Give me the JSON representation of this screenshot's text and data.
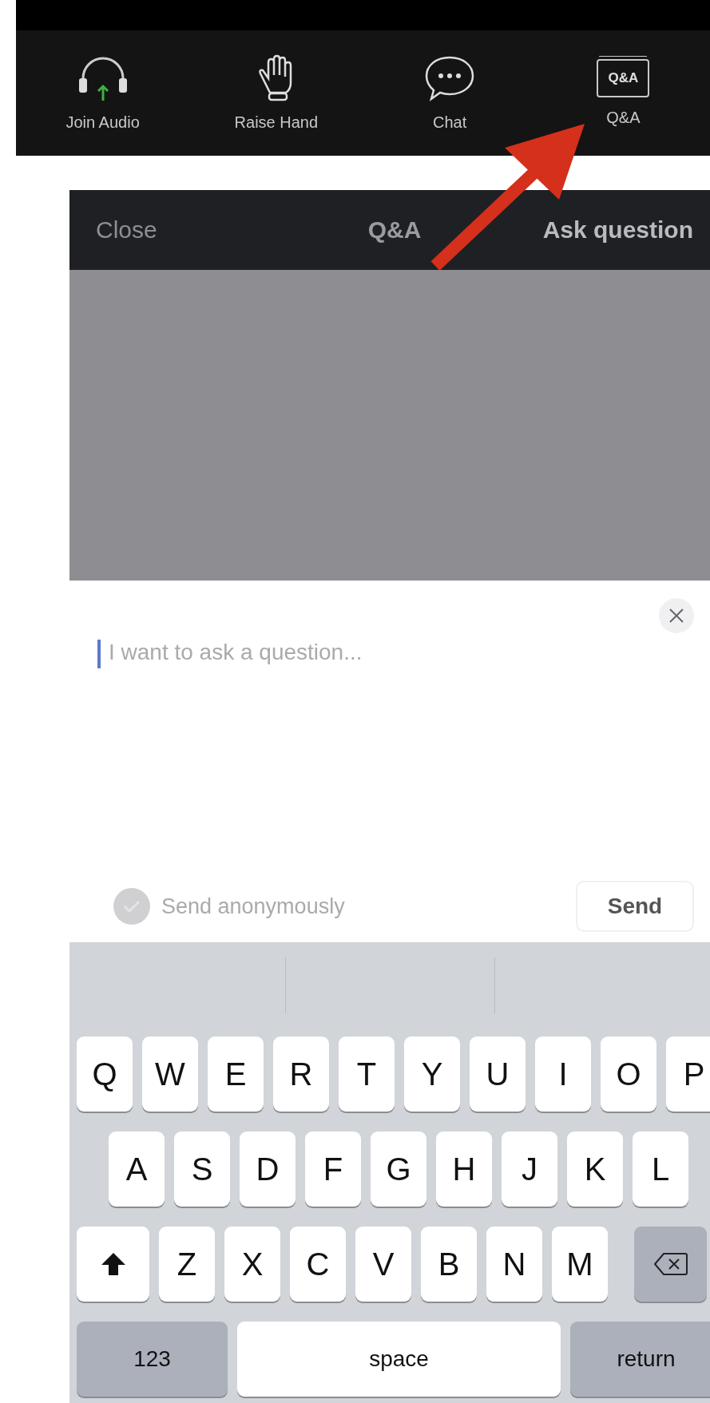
{
  "toolbar": {
    "items": [
      {
        "kind": "headphones",
        "label": "Join Audio"
      },
      {
        "kind": "hand",
        "label": "Raise Hand"
      },
      {
        "kind": "chat",
        "label": "Chat"
      },
      {
        "kind": "qa",
        "label": "Q&A",
        "icon_text": "Q&A"
      }
    ]
  },
  "header": {
    "close": "Close",
    "title": "Q&A",
    "action": "Ask question"
  },
  "question_sheet": {
    "placeholder": "I want to ask a question...",
    "anonymous": {
      "label": "Send anonymously",
      "checked": false
    },
    "send": "Send"
  },
  "keyboard": {
    "rows": [
      [
        {
          "kind": "letter",
          "label": "Q"
        },
        {
          "kind": "letter",
          "label": "W"
        },
        {
          "kind": "letter",
          "label": "E"
        },
        {
          "kind": "letter",
          "label": "R"
        },
        {
          "kind": "letter",
          "label": "T"
        },
        {
          "kind": "letter",
          "label": "Y"
        },
        {
          "kind": "letter",
          "label": "U"
        },
        {
          "kind": "letter",
          "label": "I"
        },
        {
          "kind": "letter",
          "label": "O"
        },
        {
          "kind": "letter",
          "label": "P"
        }
      ],
      [
        {
          "kind": "letter",
          "label": "A"
        },
        {
          "kind": "letter",
          "label": "S"
        },
        {
          "kind": "letter",
          "label": "D"
        },
        {
          "kind": "letter",
          "label": "F"
        },
        {
          "kind": "letter",
          "label": "G"
        },
        {
          "kind": "letter",
          "label": "H"
        },
        {
          "kind": "letter",
          "label": "J"
        },
        {
          "kind": "letter",
          "label": "K"
        },
        {
          "kind": "letter",
          "label": "L"
        }
      ],
      [
        {
          "kind": "shift"
        },
        {
          "kind": "letter",
          "label": "Z"
        },
        {
          "kind": "letter",
          "label": "X"
        },
        {
          "kind": "letter",
          "label": "C"
        },
        {
          "kind": "letter",
          "label": "V"
        },
        {
          "kind": "letter",
          "label": "B"
        },
        {
          "kind": "letter",
          "label": "N"
        },
        {
          "kind": "letter",
          "label": "M"
        },
        {
          "kind": "delete"
        }
      ]
    ],
    "bottom_row": {
      "numbers": "123",
      "space": "space",
      "return": "return"
    }
  }
}
